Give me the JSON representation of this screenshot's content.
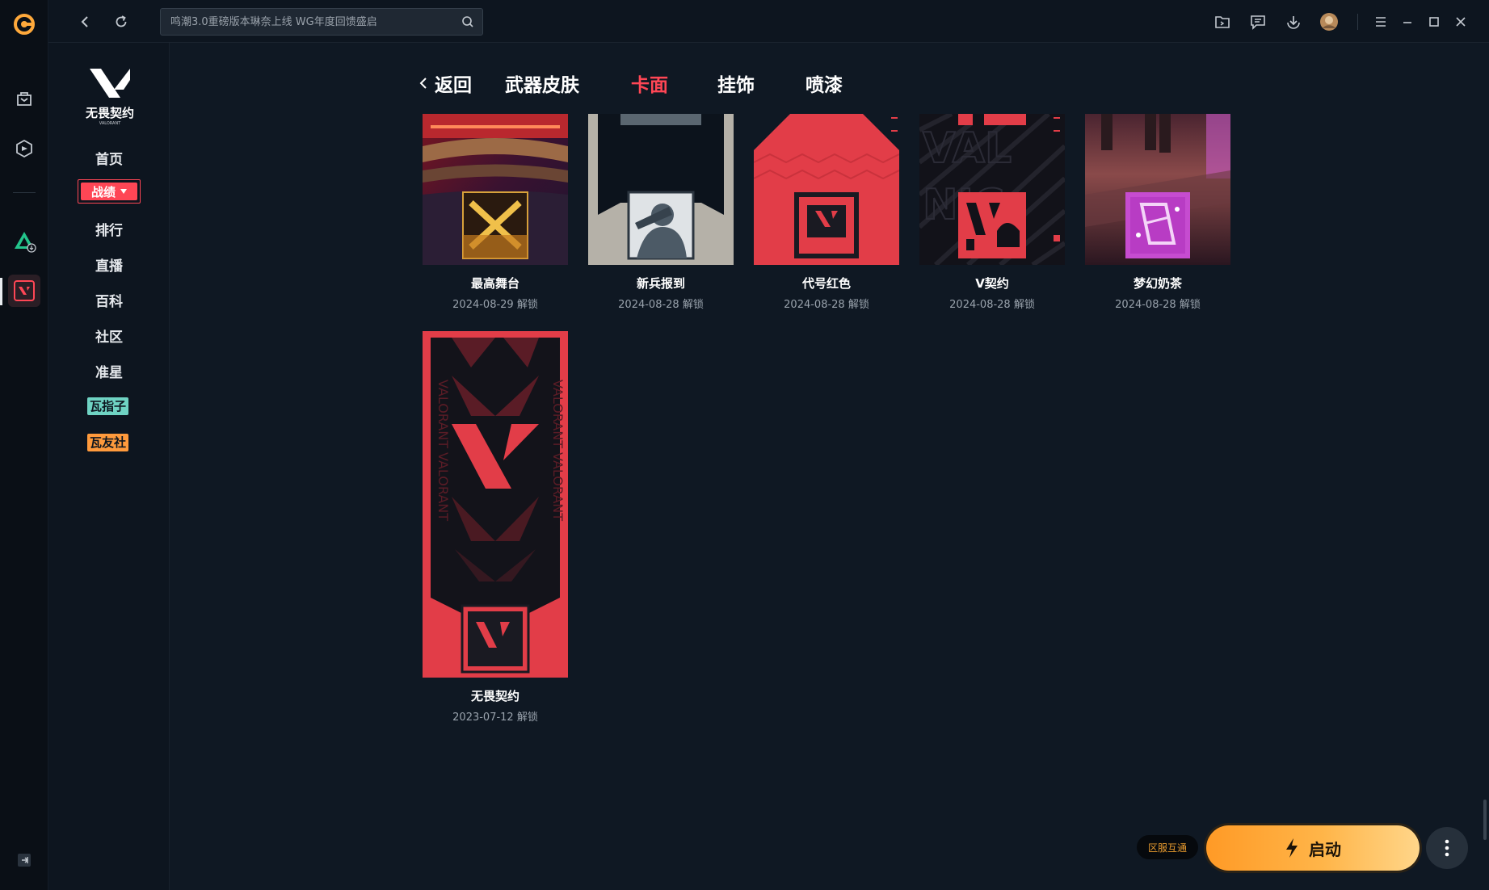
{
  "search": {
    "placeholder": "鸣潮3.0重磅版本琳奈上线 WG年度回馈盛启"
  },
  "sidebar": {
    "logo_text": "无畏契约",
    "logo_sub": "VALORANT",
    "items": [
      {
        "label": "首页"
      },
      {
        "label": "战绩"
      },
      {
        "label": "排行"
      },
      {
        "label": "直播"
      },
      {
        "label": "百科"
      },
      {
        "label": "社区"
      },
      {
        "label": "准星"
      },
      {
        "label": "瓦指子"
      },
      {
        "label": "瓦友社"
      }
    ]
  },
  "tabs": {
    "back": "返回",
    "items": [
      {
        "label": "武器皮肤"
      },
      {
        "label": "卡面"
      },
      {
        "label": "挂饰"
      },
      {
        "label": "喷漆"
      }
    ]
  },
  "cards": [
    {
      "name": "最高舞台",
      "date": "2024-08-29 解锁"
    },
    {
      "name": "新兵报到",
      "date": "2024-08-28 解锁"
    },
    {
      "name": "代号红色",
      "date": "2024-08-28 解锁"
    },
    {
      "name": "V契约",
      "date": "2024-08-28 解锁"
    },
    {
      "name": "梦幻奶茶",
      "date": "2024-08-28 解锁"
    },
    {
      "name": "无畏契约",
      "date": "2023-07-12 解锁"
    }
  ],
  "footer": {
    "region_label": "区服互通",
    "launch_label": "启动"
  },
  "colors": {
    "accent_red": "#ff4655",
    "launch_orange": "#ffa93b",
    "background": "#0f1823"
  }
}
